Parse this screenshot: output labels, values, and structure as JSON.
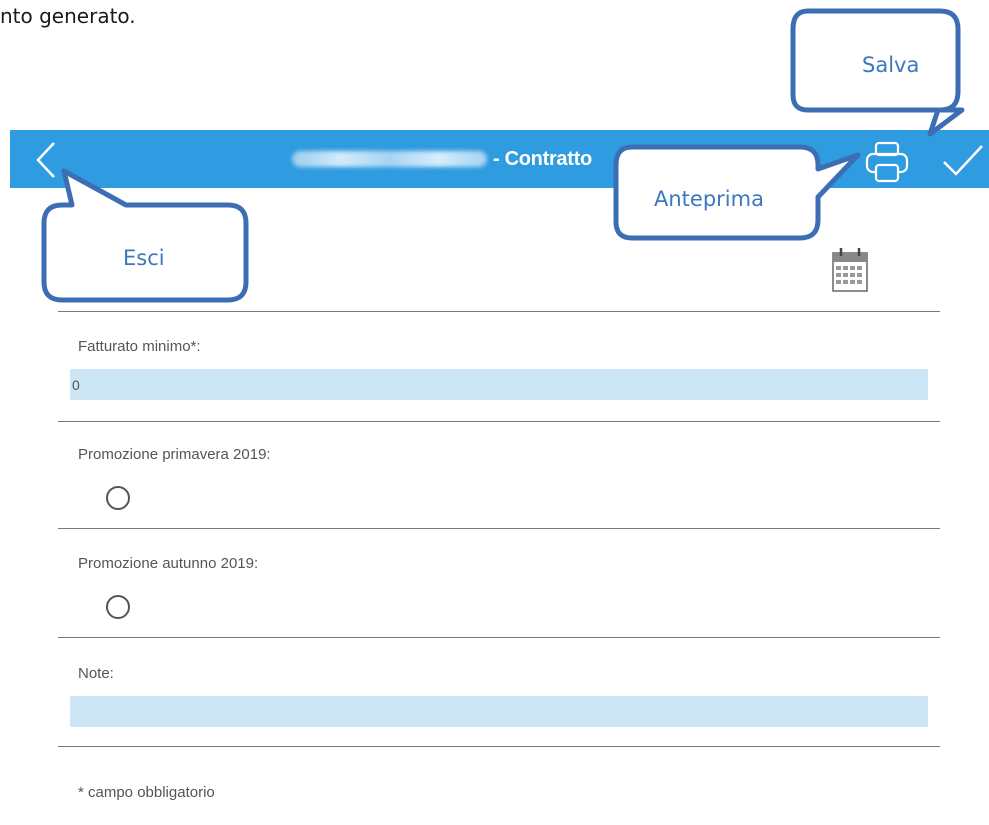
{
  "intro": {
    "text": "nto generato."
  },
  "topbar": {
    "title_suffix": "- Contratto",
    "back_icon": "chevron-left-icon",
    "print_icon": "printer-icon",
    "save_icon": "check-icon",
    "color": "#2f9be0"
  },
  "callouts": {
    "salva": "Salva",
    "anteprima": "Anteprima",
    "esci": "Esci",
    "border_color": "#3c6eb4",
    "text_color": "#3c78c0"
  },
  "form": {
    "calendar_icon": "calendar-icon",
    "fatturato": {
      "label": "Fatturato minimo*:",
      "value": "0"
    },
    "promo_primavera": {
      "label": "Promozione primavera 2019:",
      "checked": false
    },
    "promo_autunno": {
      "label": "Promozione autunno 2019:",
      "checked": false
    },
    "note": {
      "label": "Note:",
      "value": ""
    },
    "input_bg": "#cde6f6"
  },
  "footnote": "* campo obbligatorio"
}
